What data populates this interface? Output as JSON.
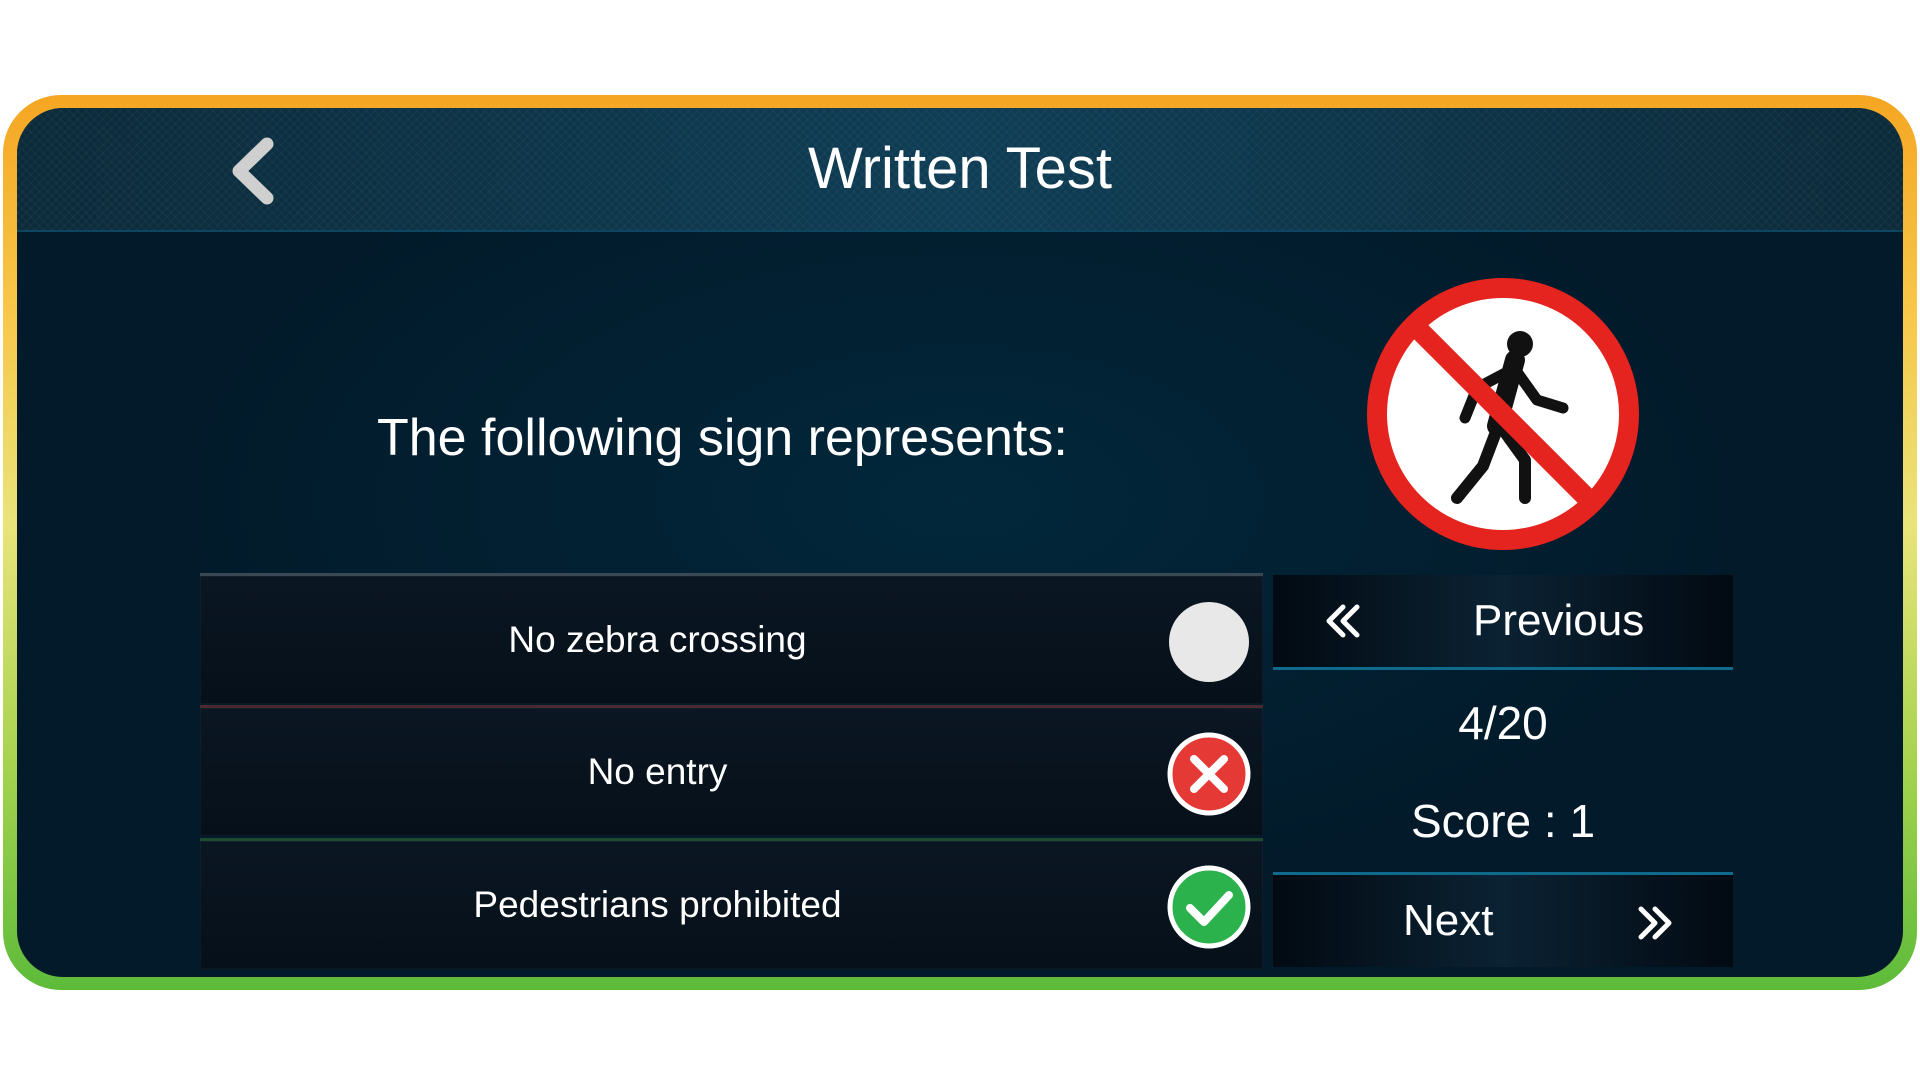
{
  "header": {
    "title": "Written Test",
    "back_icon": "chevron-left-icon"
  },
  "question": {
    "text": "The following sign represents:",
    "sign_icon": "no-pedestrians-sign"
  },
  "options": [
    {
      "label": "No zebra crossing",
      "state": "unselected"
    },
    {
      "label": "No entry",
      "state": "wrong"
    },
    {
      "label": "Pedestrians prohibited",
      "state": "correct"
    }
  ],
  "navigation": {
    "previous_label": "Previous",
    "next_label": "Next",
    "progress": "4/20",
    "score": "Score : 1"
  },
  "colors": {
    "frame_top": "#f5a623",
    "frame_bottom": "#5dbb3a",
    "background": "#021a2a",
    "wrong": "#e53935",
    "correct": "#2bb24c",
    "unselected": "#e8e8e8"
  }
}
